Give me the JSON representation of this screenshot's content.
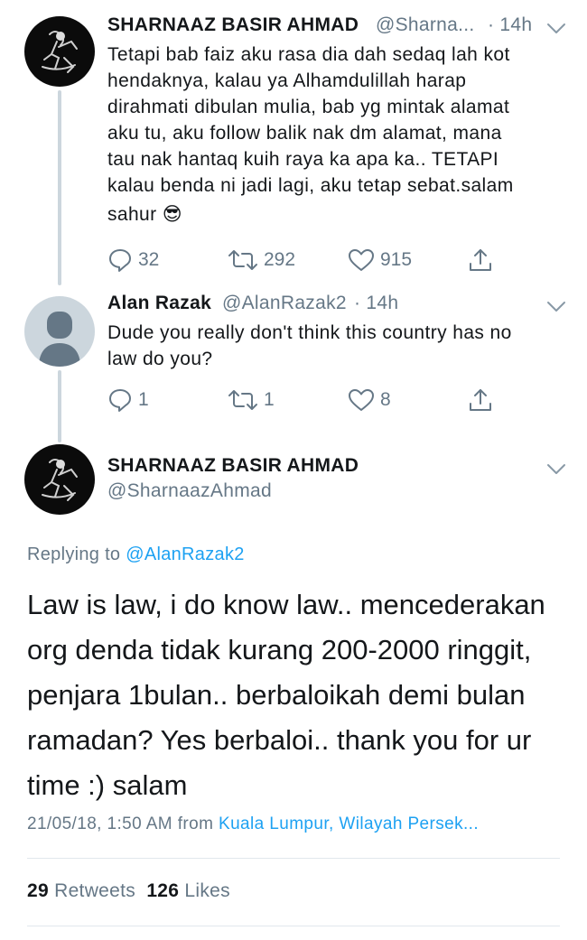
{
  "tweet1": {
    "author_name": "SHARNAAZ BASIR AHMAD",
    "author_handle": "@Sharna...",
    "time": "· 14h",
    "lines": [
      "Tetapi bab faiz aku rasa dia dah sedaq lah kot",
      "hendaknya, kalau ya Alhamdulillah harap",
      "dirahmati dibulan mulia, bab yg mintak alamat",
      "aku tu, aku follow balik nak dm alamat, mana",
      "tau nak hantaq kuih raya ka apa ka.. TETAPI",
      "kalau benda ni jadi lagi, aku tetap sebat.salam",
      "sahur"
    ],
    "emoji": "😎",
    "replies": "32",
    "retweets": "292",
    "likes": "915"
  },
  "tweet2": {
    "author_name": "Alan Razak",
    "author_handle": "@AlanRazak2",
    "time": "· 14h",
    "lines": [
      "Dude you really don't think this country has no",
      "law do you?"
    ],
    "replies": "1",
    "retweets": "1",
    "likes": "8"
  },
  "main_tweet": {
    "author_name": "SHARNAAZ BASIR AHMAD",
    "author_handle": "@SharnaazAhmad",
    "replying_prefix": "Replying to",
    "replying_to": "@AlanRazak2",
    "lines": [
      "Law is law, i do know law.. mencederakan",
      "org denda tidak kurang 200-2000 ringgit,",
      "penjara 1bulan.. berbaloikah demi bulan",
      "ramadan? Yes berbaloi.. thank you for ur",
      "time :) salam"
    ],
    "timestamp": "21/05/18, 1:50 AM from",
    "location": "Kuala Lumpur, Wilayah Persek...",
    "retweet_count": "29",
    "retweet_label": "Retweets",
    "like_count": "126",
    "like_label": "Likes"
  },
  "icons": {
    "reply": "reply-icon",
    "retweet": "retweet-icon",
    "like": "heart-icon",
    "share": "share-icon",
    "menu": "chevron-down-icon"
  },
  "colors": {
    "text": "#14171a",
    "secondary": "#657786",
    "link": "#1da1f2",
    "thread_line": "#ccd6dd"
  }
}
